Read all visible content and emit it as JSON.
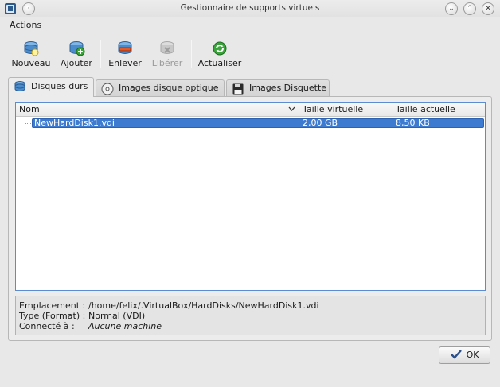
{
  "window": {
    "title": "Gestionnaire de supports virtuels"
  },
  "menubar": {
    "actions_label": "Actions"
  },
  "toolbar": {
    "new_label": "Nouveau",
    "add_label": "Ajouter",
    "remove_label": "Enlever",
    "release_label": "Libérer",
    "refresh_label": "Actualiser"
  },
  "tabs": {
    "hard_disks": "Disques durs",
    "optical_images": "Images disque optique",
    "floppy_images": "Images Disquette"
  },
  "table": {
    "columns": {
      "name": "Nom",
      "virtual_size": "Taille virtuelle",
      "actual_size": "Taille actuelle"
    },
    "rows": [
      {
        "name": "NewHardDisk1.vdi",
        "virtual_size": "2,00 GB",
        "actual_size": "8,50 KB",
        "selected": true
      }
    ]
  },
  "details": {
    "location_label": "Emplacement :",
    "location_value": "/home/felix/.VirtualBox/HardDisks/NewHardDisk1.vdi",
    "type_label": "Type (Format) :",
    "type_value": "Normal (VDI)",
    "attached_label": "Connecté à :",
    "attached_value": "Aucune machine"
  },
  "footer": {
    "ok_label": "OK"
  },
  "colors": {
    "selection": "#3d7bd0",
    "focus_border": "#5b8bd0"
  }
}
